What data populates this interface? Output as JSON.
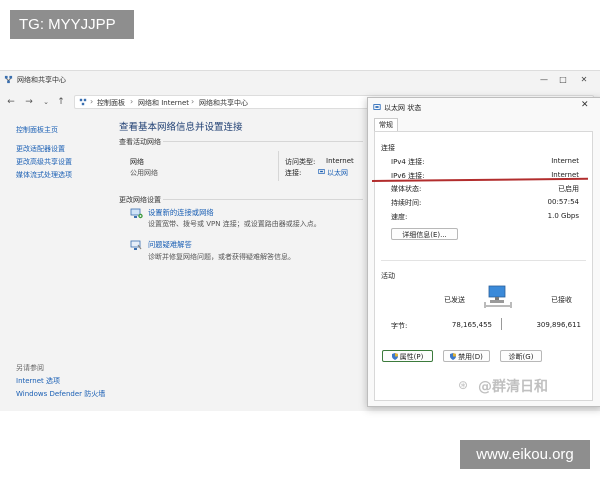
{
  "watermarks": {
    "top_left": "TG: MYYJJPP",
    "bottom_right": "www.eikou.org",
    "overlay": "@群清日和"
  },
  "main_window": {
    "title": "网络和共享中心",
    "controls": {
      "minimize": "—",
      "maximize": "□",
      "close": "✕"
    },
    "breadcrumb": [
      "控制面板",
      "网络和 Internet",
      "网络和共享中心"
    ],
    "sidebar": {
      "links": [
        "控制面板主页",
        "更改适配器设置",
        "更改高级共享设置",
        "媒体流式处理选项"
      ],
      "see_also_title": "另请参阅",
      "see_also": [
        "Internet 选项",
        "Windows Defender 防火墙"
      ]
    },
    "heading": "查看基本网络信息并设置连接",
    "active_networks_title": "查看活动网络",
    "network": {
      "name": "网络",
      "type": "公用网络",
      "access_label": "访问类型:",
      "access_value": "Internet",
      "conn_label": "连接:",
      "conn_value": "以太网"
    },
    "change_settings_title": "更改网络设置",
    "actions": [
      {
        "title": "设置新的连接或网络",
        "desc": "设置宽带、拨号或 VPN 连接；或设置路由器或接入点。"
      },
      {
        "title": "问题疑难解答",
        "desc": "诊断并修复网络问题，或者获得疑难解答信息。"
      }
    ]
  },
  "dialog": {
    "title": "以太网 状态",
    "close": "✕",
    "tab": "常规",
    "connection_title": "连接",
    "rows": [
      {
        "label": "IPv4 连接:",
        "value": "Internet"
      },
      {
        "label": "IPv6 连接:",
        "value": "Internet"
      },
      {
        "label": "媒体状态:",
        "value": "已启用"
      },
      {
        "label": "持续时间:",
        "value": "00:57:54"
      },
      {
        "label": "速度:",
        "value": "1.0 Gbps"
      }
    ],
    "details_button": "详细信息(E)...",
    "activity_title": "活动",
    "sent_label": "已发送",
    "received_label": "已接收",
    "bytes_label": "字节:",
    "bytes_sent": "78,165,455",
    "bytes_received": "309,896,611",
    "buttons": {
      "properties": "属性(P)",
      "disable": "禁用(D)",
      "diagnose": "诊断(G)"
    }
  },
  "colors": {
    "accent_link": "#1a5fb4",
    "heading": "#1f3f73",
    "annotation_line": "#b22d2d"
  }
}
